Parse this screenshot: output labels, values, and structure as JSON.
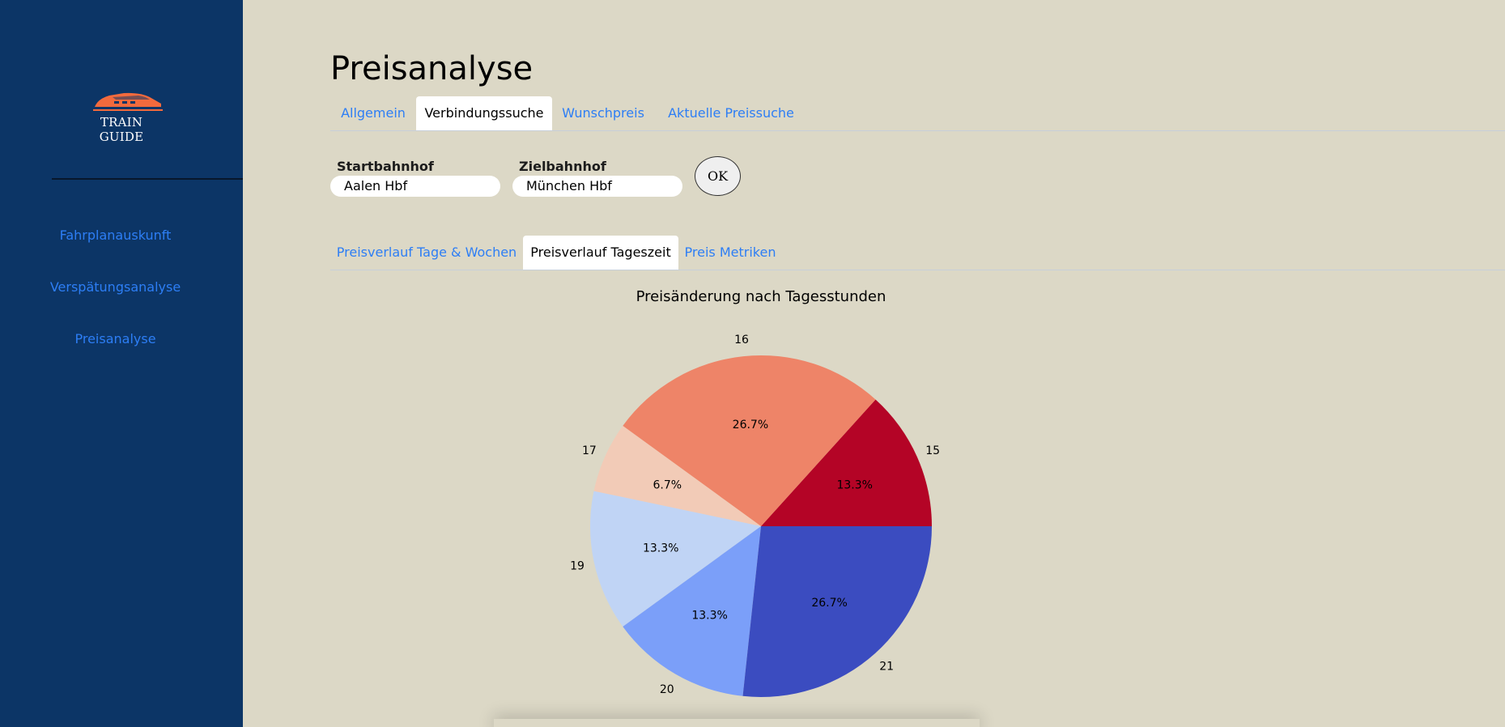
{
  "sidebar": {
    "logo_text": "TRAIN GUIDE",
    "items": [
      {
        "label": "Fahrplanauskunft"
      },
      {
        "label": "Verspätungsanalyse"
      },
      {
        "label": "Preisanalyse"
      }
    ]
  },
  "page": {
    "title": "Preisanalyse"
  },
  "tabs": [
    {
      "label": "Allgemein",
      "active": false
    },
    {
      "label": "Verbindungssuche",
      "active": true
    },
    {
      "label": "Wunschpreis",
      "active": false
    },
    {
      "label": "Aktuelle Preissuche",
      "active": false
    }
  ],
  "form": {
    "start_label": "Startbahnhof",
    "start_value": "Aalen Hbf",
    "end_label": "Zielbahnhof",
    "end_value": "München Hbf",
    "ok_label": "OK"
  },
  "subtabs": [
    {
      "label": "Preisverlauf Tage & Wochen",
      "active": false
    },
    {
      "label": "Preisverlauf Tageszeit",
      "active": true
    },
    {
      "label": "Preis Metriken",
      "active": false
    }
  ],
  "colors": {
    "sidebar_bg": "#0c3566",
    "page_bg": "#dcd8c6",
    "link": "#2d7ef5",
    "logo": "#f26a3d"
  },
  "chart_data": {
    "type": "pie",
    "title": "Preisänderung nach Tagesstunden",
    "categories": [
      "15",
      "16",
      "17",
      "19",
      "20",
      "21"
    ],
    "values": [
      13.3,
      26.7,
      6.7,
      13.3,
      13.3,
      26.7
    ],
    "value_labels": [
      "13.3%",
      "26.7%",
      "6.7%",
      "13.3%",
      "13.3%",
      "26.7%"
    ],
    "colors": [
      "#b40426",
      "#ee8468",
      "#f2cbb7",
      "#c0d4f5",
      "#7b9ff9",
      "#3b4cc0"
    ],
    "start_angle_deg": 0,
    "direction": "counterclockwise"
  }
}
